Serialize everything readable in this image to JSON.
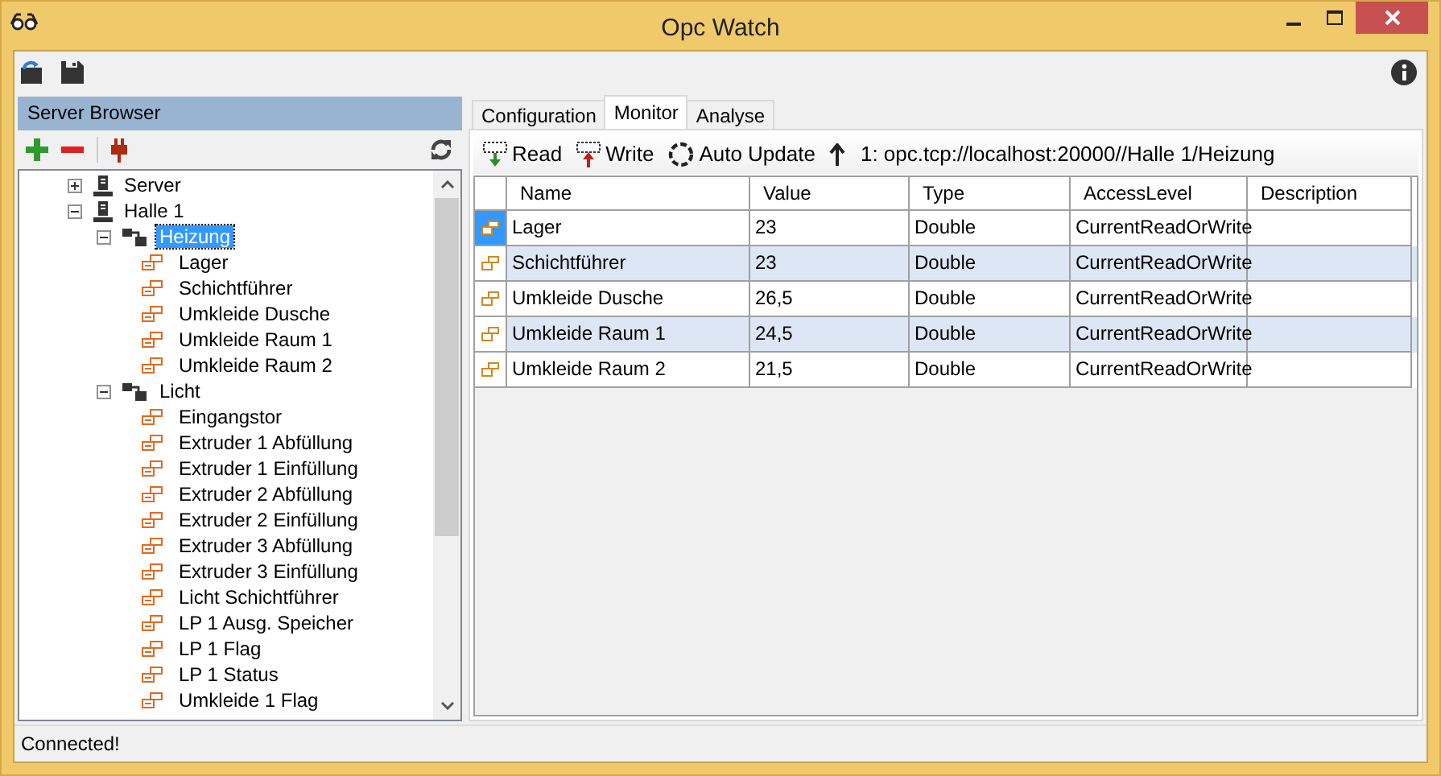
{
  "window": {
    "title": "Opc Watch"
  },
  "panel": {
    "title": "Server Browser"
  },
  "tree": [
    {
      "label": "Server",
      "kind": "server",
      "expanded": false,
      "selected": false
    },
    {
      "label": "Halle 1",
      "kind": "server",
      "expanded": true,
      "selected": false,
      "children": [
        {
          "label": "Heizung",
          "kind": "folder",
          "expanded": true,
          "selected": true,
          "children": [
            {
              "label": "Lager",
              "kind": "variable",
              "selected": false
            },
            {
              "label": "Schichtführer",
              "kind": "variable",
              "selected": false
            },
            {
              "label": "Umkleide Dusche",
              "kind": "variable",
              "selected": false
            },
            {
              "label": "Umkleide Raum 1",
              "kind": "variable",
              "selected": false
            },
            {
              "label": "Umkleide Raum 2",
              "kind": "variable",
              "selected": false
            }
          ]
        },
        {
          "label": "Licht",
          "kind": "folder",
          "expanded": true,
          "selected": false,
          "children": [
            {
              "label": "Eingangstor",
              "kind": "variable",
              "selected": false
            },
            {
              "label": "Extruder 1 Abfüllung",
              "kind": "variable",
              "selected": false
            },
            {
              "label": "Extruder 1 Einfüllung",
              "kind": "variable",
              "selected": false
            },
            {
              "label": "Extruder 2 Abfüllung",
              "kind": "variable",
              "selected": false
            },
            {
              "label": "Extruder 2 Einfüllung",
              "kind": "variable",
              "selected": false
            },
            {
              "label": "Extruder 3 Abfüllung",
              "kind": "variable",
              "selected": false
            },
            {
              "label": "Extruder 3 Einfüllung",
              "kind": "variable",
              "selected": false
            },
            {
              "label": "Licht Schichtführer",
              "kind": "variable",
              "selected": false
            },
            {
              "label": "LP 1 Ausg. Speicher",
              "kind": "variable",
              "selected": false
            },
            {
              "label": "LP 1 Flag",
              "kind": "variable",
              "selected": false
            },
            {
              "label": "LP 1 Status",
              "kind": "variable",
              "selected": false
            },
            {
              "label": "Umkleide 1 Flag",
              "kind": "variable",
              "selected": false
            }
          ]
        }
      ]
    }
  ],
  "tabs": [
    {
      "label": "Configuration",
      "selected": false
    },
    {
      "label": "Monitor",
      "selected": true
    },
    {
      "label": "Analyse",
      "selected": false
    }
  ],
  "monitor_toolbar": {
    "read": "Read",
    "write": "Write",
    "auto_update": "Auto Update",
    "path": "1: opc.tcp://localhost:20000//Halle 1/Heizung"
  },
  "table": {
    "columns": [
      "Name",
      "Value",
      "Type",
      "AccessLevel",
      "Description"
    ],
    "rows": [
      {
        "name": "Lager",
        "value": "23",
        "type": "Double",
        "access": "CurrentReadOrWrite",
        "selected": true
      },
      {
        "name": "Schichtführer",
        "value": "23",
        "type": "Double",
        "access": "CurrentReadOrWrite",
        "selected": false
      },
      {
        "name": "Umkleide Dusche",
        "value": "26,5",
        "type": "Double",
        "access": "CurrentReadOrWrite",
        "selected": false
      },
      {
        "name": "Umkleide Raum 1",
        "value": "24,5",
        "type": "Double",
        "access": "CurrentReadOrWrite",
        "selected": false
      },
      {
        "name": "Umkleide Raum 2",
        "value": "21,5",
        "type": "Double",
        "access": "CurrentReadOrWrite",
        "selected": false
      }
    ]
  },
  "status_bar": "Connected!"
}
